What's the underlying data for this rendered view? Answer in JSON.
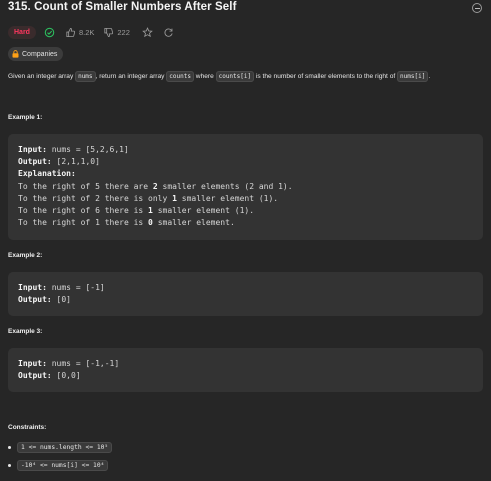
{
  "problem": {
    "title": "315. Count of Smaller Numbers After Self",
    "difficulty": "Hard",
    "likes": "8.2K",
    "dislikes": "222",
    "companies_label": "Companies",
    "colors": {
      "hard": "#ff375f",
      "solved": "#2cbb5d",
      "background": "#262626"
    }
  },
  "description": {
    "p1": "Given an integer array ",
    "c1": "nums",
    "p2": ", return an integer array ",
    "c2": "counts",
    "p3": " where ",
    "c3": "counts[i]",
    "p4": " is the number of smaller elements to the right of ",
    "c4": "nums[i]",
    "p5": "."
  },
  "examples": [
    {
      "title": "Example 1:",
      "input_label": "Input:",
      "input": "nums = [5,2,6,1]",
      "output_label": "Output:",
      "output": "[2,1,1,0]",
      "explanation_label": "Explanation:",
      "explanation": [
        {
          "pre": "To the right of 5 there are ",
          "bold": "2",
          "post": " smaller elements (2 and 1)."
        },
        {
          "pre": "To the right of 2 there is only ",
          "bold": "1",
          "post": " smaller element (1)."
        },
        {
          "pre": "To the right of 6 there is ",
          "bold": "1",
          "post": " smaller element (1)."
        },
        {
          "pre": "To the right of 1 there is ",
          "bold": "0",
          "post": " smaller element."
        }
      ]
    },
    {
      "title": "Example 2:",
      "input_label": "Input:",
      "input": "nums = [-1]",
      "output_label": "Output:",
      "output": "[0]"
    },
    {
      "title": "Example 3:",
      "input_label": "Input:",
      "input": "nums = [-1,-1]",
      "output_label": "Output:",
      "output": "[0,0]"
    }
  ],
  "constraints": {
    "title": "Constraints:",
    "items": [
      "1 <= nums.length <= 10⁵",
      "-10⁴ <= nums[i] <= 10⁴"
    ]
  }
}
